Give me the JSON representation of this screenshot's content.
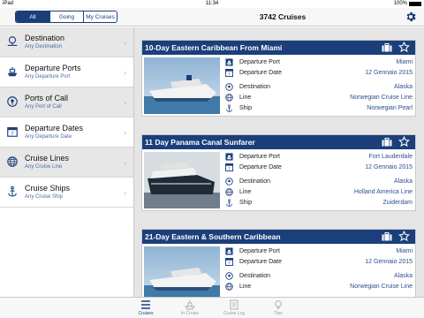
{
  "status_bar": {
    "device": "iPad",
    "time": "11:34",
    "battery": "100%"
  },
  "nav": {
    "segments": [
      "All",
      "Going",
      "My Cruises"
    ],
    "active_segment": "All",
    "title": "3742 Cruises",
    "settings_icon": "gear-icon"
  },
  "sidebar": {
    "items": [
      {
        "title": "Destination",
        "subtitle": "Any Destination",
        "icon": "globe-pin-icon"
      },
      {
        "title": "Departure Ports",
        "subtitle": "Any Departure Port",
        "icon": "ship-icon"
      },
      {
        "title": "Ports of Call",
        "subtitle": "Any Port of Call",
        "icon": "location-pin-icon"
      },
      {
        "title": "Departure Dates",
        "subtitle": "Any Departure Date",
        "icon": "calendar-icon"
      },
      {
        "title": "Cruise Lines",
        "subtitle": "Any Cruise Line",
        "icon": "globe-icon"
      },
      {
        "title": "Cruise Ships",
        "subtitle": "Any Cruise Ship",
        "icon": "anchor-icon"
      }
    ]
  },
  "cruises": [
    {
      "title": "10-Day Eastern Caribbean From Miami",
      "departure_port_label": "Departure Port",
      "departure_port": "Miami",
      "departure_date_label": "Departure Date",
      "departure_date": "12 Gennaio 2015",
      "destination_label": "Destination",
      "destination": "Alaska",
      "line_label": "Line",
      "line": "Norwegian Cruise Line",
      "ship_label": "Ship",
      "ship": "Norwegian Pearl"
    },
    {
      "title": "11 Day Panama Canal Sunfarer",
      "departure_port_label": "Departure Port",
      "departure_port": "Fort Lauderdale",
      "departure_date_label": "Departure Date",
      "departure_date": "12 Gennaio 2015",
      "destination_label": "Destination",
      "destination": "Alaska",
      "line_label": "Line",
      "line": "Holland America Line",
      "ship_label": "Ship",
      "ship": "Zuiderdam"
    },
    {
      "title": "21-Day Eastern & Southern Caribbean",
      "departure_port_label": "Departure Port",
      "departure_port": "Miami",
      "departure_date_label": "Departure Date",
      "departure_date": "12 Gennaio 2015",
      "destination_label": "Destination",
      "destination": "Alaska",
      "line_label": "Line",
      "line": "Norwegian Cruise Line"
    }
  ],
  "tabbar": {
    "tabs": [
      {
        "label": "Cruises",
        "icon": "list-icon",
        "active": true
      },
      {
        "label": "In Cruise",
        "icon": "ship-icon",
        "active": false
      },
      {
        "label": "Cruise Log",
        "icon": "notebook-icon",
        "active": false
      },
      {
        "label": "Tips",
        "icon": "lightbulb-icon",
        "active": false
      }
    ]
  },
  "colors": {
    "brand": "#1b3f7a",
    "link": "#2b4f8f",
    "subtitle": "#4a6da7",
    "background": "#e5e5e5"
  }
}
